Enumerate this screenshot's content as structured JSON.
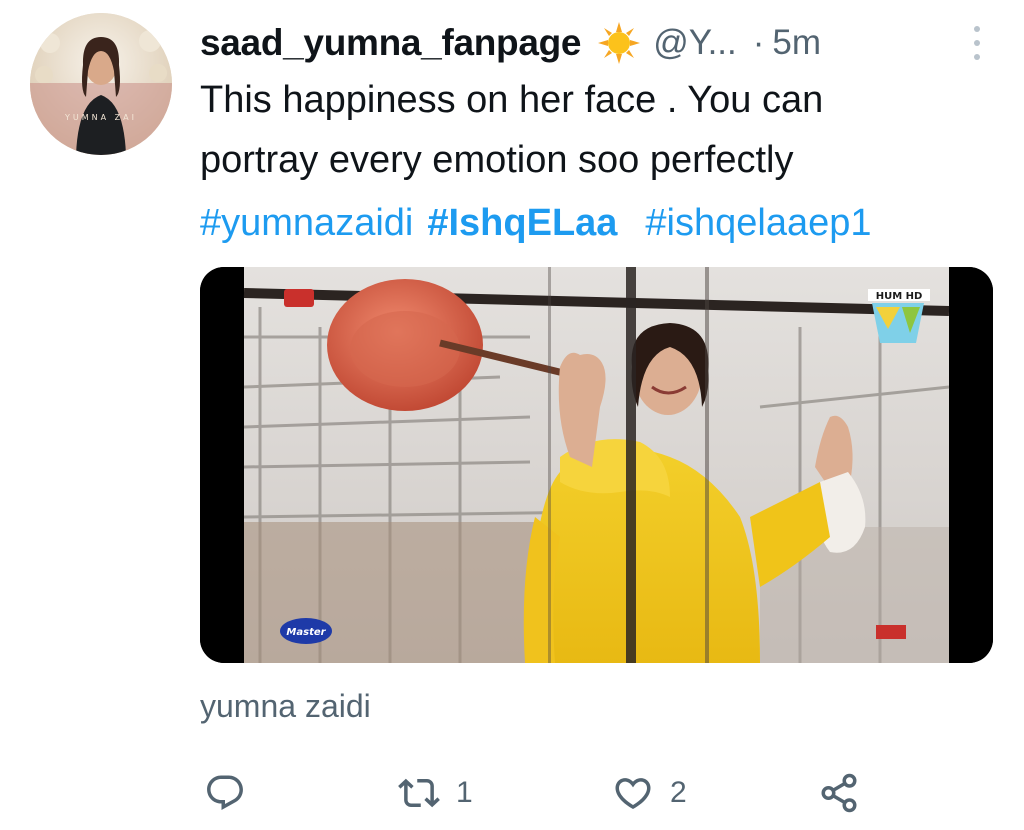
{
  "tweet": {
    "display_name": "saad_yumna_fanpage",
    "badge_icon": "sun-emoji",
    "handle": "@Y...",
    "separator": "·",
    "time": "5m",
    "text_line1": "This happiness on her face . You can",
    "text_line2": "portray every emotion soo perfectly",
    "hashtags": [
      "#yumnazaidi",
      "#IshqELaa",
      "#ishqelaaep1"
    ],
    "caption": "yumna zaidi",
    "avatar_watermark": "YUMNA ZAI"
  },
  "media": {
    "channel_logo_text": "HUM HD",
    "sponsor_logo_text": "Master"
  },
  "actions": {
    "reply_icon": "reply-icon",
    "retweet_icon": "retweet-icon",
    "retweet_count": "1",
    "like_icon": "heart-icon",
    "like_count": "2",
    "share_icon": "share-icon"
  },
  "colors": {
    "link": "#1d9bf0",
    "secondary_text": "#536471",
    "primary_text": "#0f1419"
  }
}
